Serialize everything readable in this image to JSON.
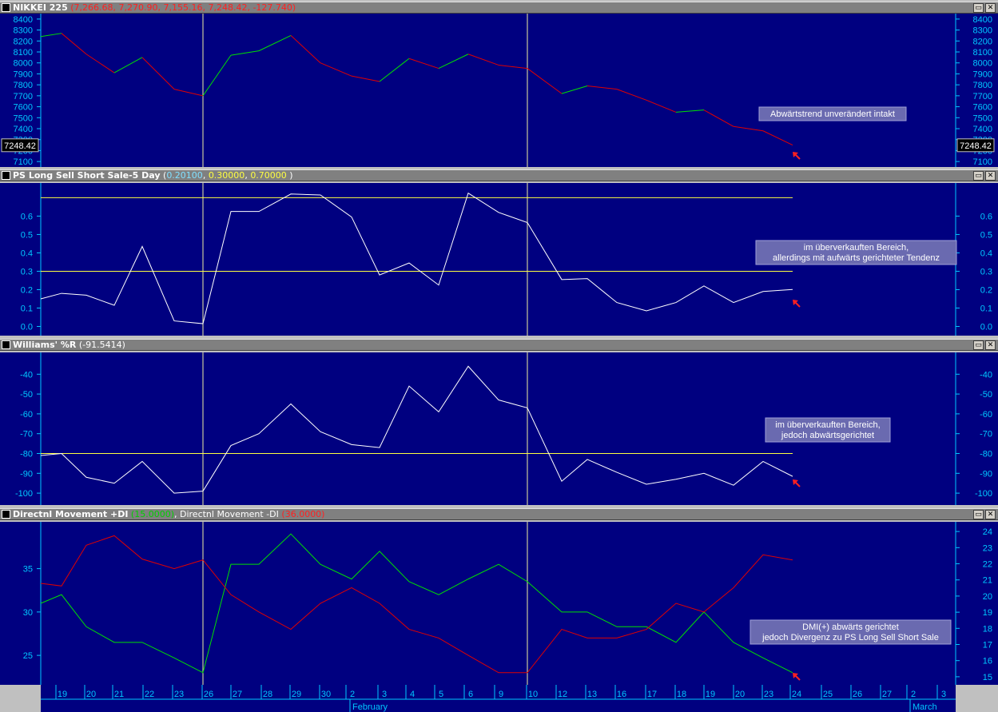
{
  "colors": {
    "background": "#000080",
    "axis_text": "#00c8ff",
    "grid_line": "#f0f0a0",
    "up": "#00e000",
    "down": "#e00000",
    "white_line": "#ffffff",
    "yellow": "#ffff40",
    "annotation_bg": "#6a6ab0",
    "arrow": "#ff2020"
  },
  "window_controls": {
    "restore": "▭",
    "close": "✕"
  },
  "panels": [
    {
      "id": "nikkei",
      "name": "NIKKEI 225",
      "params": [
        {
          "text": "(7,266.68, 7,270.90, 7,155.16, 7,248.42, -127.740)",
          "color": "#ff2020"
        }
      ],
      "annotation": [
        "Abwärtstrend unverändert intakt"
      ],
      "last_value": "7248.42"
    },
    {
      "id": "ps",
      "name": "PS Long Sell Short Sale-5 Day",
      "params": [
        {
          "text": "(",
          "color": "#ffffff"
        },
        {
          "text": "0.20100",
          "color": "#80e0ff"
        },
        {
          "text": ", ",
          "color": "#ffffff"
        },
        {
          "text": "0.30000",
          "color": "#ffff40"
        },
        {
          "text": ", ",
          "color": "#ffffff"
        },
        {
          "text": "0.70000",
          "color": "#ffff40"
        },
        {
          "text": " )",
          "color": "#ffffff"
        }
      ],
      "annotation": [
        "im überverkauften Bereich,",
        "allerdings mit aufwärts gerichteter Tendenz"
      ]
    },
    {
      "id": "williams",
      "name": "Williams' %R",
      "params": [
        {
          "text": "(",
          "color": "#ffffff"
        },
        {
          "text": "-91.5414",
          "color": "#ffffff"
        },
        {
          "text": ")",
          "color": "#ffffff"
        }
      ],
      "annotation": [
        "im überverkauften Bereich,",
        "jedoch abwärtsgerichtet"
      ]
    },
    {
      "id": "dmi",
      "name": "Directnl Movement +DI",
      "params": [
        {
          "text": "(15.0000)",
          "color": "#00d000"
        },
        {
          "text": ", Directnl Movement -DI ",
          "color": "#ffffff"
        },
        {
          "text": "(36.0000)",
          "color": "#ff2020"
        }
      ],
      "annotation": [
        "DMI(+) abwärts gerichtet",
        "jedoch Divergenz zu PS Long Sell Short Sale"
      ]
    }
  ],
  "x_axis": {
    "day_labels": [
      "19",
      "20",
      "21",
      "22",
      "23",
      "26",
      "27",
      "28",
      "29",
      "30",
      "2",
      "3",
      "4",
      "5",
      "6",
      "9",
      "10",
      "12",
      "13",
      "16",
      "17",
      "18",
      "19",
      "20",
      "23",
      "24",
      "25",
      "26",
      "27",
      "2",
      "3"
    ],
    "month_labels": [
      "February",
      "March"
    ]
  },
  "chart_data": [
    {
      "type": "line",
      "title": "NIKKEI 225",
      "x": [
        "19",
        "20",
        "21",
        "22",
        "23",
        "26",
        "27",
        "28",
        "29",
        "30",
        "2",
        "3",
        "4",
        "5",
        "6",
        "9",
        "10",
        "12",
        "13",
        "16",
        "17",
        "18",
        "19",
        "20",
        "23",
        "24"
      ],
      "series": [
        {
          "name": "NIKKEI 225",
          "values": [
            8240,
            8270,
            8080,
            7910,
            8050,
            7760,
            7700,
            8070,
            8110,
            8250,
            8000,
            7880,
            7830,
            8040,
            7950,
            8080,
            7980,
            7950,
            7720,
            7790,
            7760,
            7660,
            7550,
            7570,
            7420,
            7380,
            7250
          ]
        }
      ],
      "x_extra_leading_point": true,
      "ylim": [
        7050,
        8450
      ],
      "yticks": [
        7100,
        7200,
        7300,
        7400,
        7500,
        7600,
        7700,
        7800,
        7900,
        8000,
        8100,
        8200,
        8300,
        8400
      ],
      "hlines": [],
      "up_down_coloring": true
    },
    {
      "type": "line",
      "title": "PS Long Sell Short Sale-5 Day",
      "series": [
        {
          "name": "PS Long Sell Short Sale-5 Day",
          "values": [
            0.15,
            0.18,
            0.17,
            0.115,
            0.435,
            0.03,
            0.015,
            0.625,
            0.625,
            0.72,
            0.715,
            0.595,
            0.28,
            0.345,
            0.225,
            0.725,
            0.62,
            0.565,
            0.255,
            0.26,
            0.13,
            0.085,
            0.13,
            0.22,
            0.13,
            0.19,
            0.201
          ]
        }
      ],
      "ylim": [
        -0.05,
        0.78
      ],
      "yticks": [
        0.0,
        0.1,
        0.2,
        0.3,
        0.4,
        0.5,
        0.6
      ],
      "hlines": [
        0.3,
        0.7
      ]
    },
    {
      "type": "line",
      "title": "Williams' %R",
      "series": [
        {
          "name": "Williams' %R",
          "values": [
            -81,
            -80,
            -92,
            -95,
            -84,
            -100,
            -99,
            -76,
            -70,
            -55,
            -69,
            -75.5,
            -77,
            -46,
            -59,
            -36,
            -53,
            -57,
            -94,
            -83,
            -89.5,
            -95.5,
            -93,
            -90,
            -96,
            -84,
            -91.54
          ]
        }
      ],
      "ylim": [
        -106,
        -29
      ],
      "yticks": [
        -100,
        -90,
        -80,
        -70,
        -60,
        -50,
        -40
      ],
      "hlines": [
        -80
      ]
    },
    {
      "type": "line",
      "title": "Directnl Movement",
      "series": [
        {
          "name": "Directnl Movement +DI",
          "values": [
            31,
            32,
            28.3,
            26.5,
            26.5,
            24.7,
            23,
            35.5,
            35.5,
            39,
            35.5,
            33.8,
            37,
            33.5,
            32,
            33.8,
            35.5,
            33.5,
            30,
            30,
            28.3,
            28.3,
            26.5,
            30,
            26.5,
            24.7,
            23
          ]
        },
        {
          "name": "Directnl Movement -DI",
          "values": [
            33.3,
            33,
            37.7,
            38.8,
            36.1,
            35,
            36,
            32,
            30,
            28,
            31,
            32.8,
            31,
            28,
            27,
            25,
            23,
            23,
            28,
            27,
            27,
            28,
            31,
            30,
            32.8,
            36.6,
            36
          ]
        }
      ],
      "ylim": [
        21.6,
        40.4
      ],
      "left_yticks": [
        25,
        30,
        35
      ],
      "right_yticks": [
        15,
        16,
        17,
        18,
        19,
        20,
        21,
        22,
        23,
        24
      ],
      "hlines": []
    }
  ]
}
